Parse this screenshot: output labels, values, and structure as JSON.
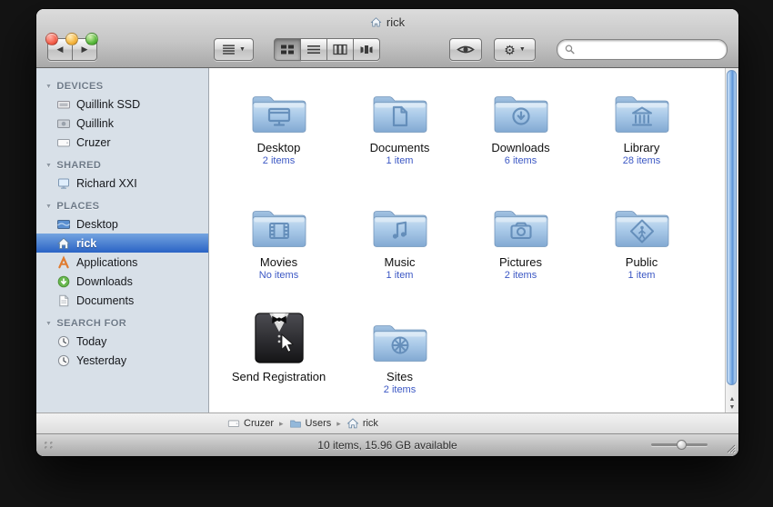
{
  "window": {
    "title": "rick"
  },
  "icons": {
    "back": "◀",
    "forward": "▶",
    "disclosure": "▼",
    "dropdown": "▼",
    "gear": "⚙",
    "path_separator": "▸",
    "scroll_up": "▲",
    "scroll_down": "▼"
  },
  "colors": {
    "sidebar_background": "#d8e0e8",
    "selection_blue_top": "#74a4e0",
    "selection_blue_bottom": "#2a63c5",
    "item_count_blue": "#3b57c4",
    "folder_blue": "#a9c9e8",
    "traffic_close": "#f4604c",
    "traffic_minimize": "#f5b53d",
    "traffic_zoom": "#59b93c"
  },
  "search": {
    "value": ""
  },
  "sidebar": {
    "sections": [
      {
        "label": "DEVICES",
        "items": [
          {
            "label": "Quillink SSD",
            "icon": "ssd-icon"
          },
          {
            "label": "Quillink",
            "icon": "internal-disk-icon"
          },
          {
            "label": "Cruzer",
            "icon": "external-drive-icon"
          }
        ]
      },
      {
        "label": "SHARED",
        "items": [
          {
            "label": "Richard XXI",
            "icon": "shared-computer-icon"
          }
        ]
      },
      {
        "label": "PLACES",
        "items": [
          {
            "label": "Desktop",
            "icon": "desktop-icon"
          },
          {
            "label": "rick",
            "icon": "home-icon",
            "selected": true
          },
          {
            "label": "Applications",
            "icon": "applications-icon"
          },
          {
            "label": "Downloads",
            "icon": "downloads-icon"
          },
          {
            "label": "Documents",
            "icon": "documents-icon"
          }
        ]
      },
      {
        "label": "SEARCH FOR",
        "items": [
          {
            "label": "Today",
            "icon": "clock-icon"
          },
          {
            "label": "Yesterday",
            "icon": "clock-icon"
          }
        ]
      }
    ]
  },
  "main": {
    "items": [
      {
        "name": "Desktop",
        "count": "2 items",
        "icon": "desktop-folder-icon"
      },
      {
        "name": "Documents",
        "count": "1 item",
        "icon": "documents-folder-icon"
      },
      {
        "name": "Downloads",
        "count": "6 items",
        "icon": "downloads-folder-icon"
      },
      {
        "name": "Library",
        "count": "28 items",
        "icon": "library-folder-icon"
      },
      {
        "name": "Movies",
        "count": "No items",
        "icon": "movies-folder-icon"
      },
      {
        "name": "Music",
        "count": "1 item",
        "icon": "music-folder-icon"
      },
      {
        "name": "Pictures",
        "count": "2 items",
        "icon": "pictures-folder-icon"
      },
      {
        "name": "Public",
        "count": "1 item",
        "icon": "public-folder-icon"
      },
      {
        "name": "Send Registration",
        "count": "",
        "icon": "send-registration-app-icon"
      },
      {
        "name": "Sites",
        "count": "2 items",
        "icon": "sites-folder-icon"
      }
    ]
  },
  "pathbar": {
    "segments": [
      "Cruzer",
      "Users",
      "rick"
    ]
  },
  "statusbar": {
    "text": "10 items, 15.96 GB available"
  }
}
